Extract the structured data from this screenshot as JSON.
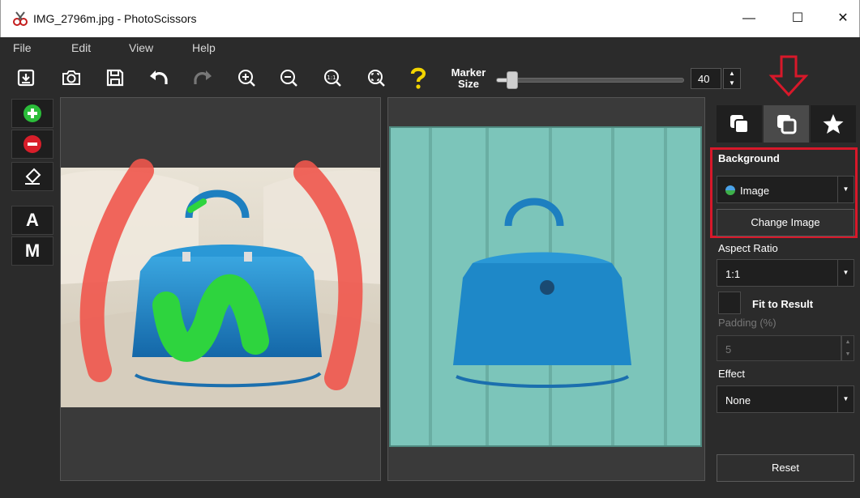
{
  "window": {
    "title": "IMG_2796m.jpg - PhotoScissors",
    "minimize": "—",
    "maximize": "☐",
    "close": "✕"
  },
  "menu": [
    "File",
    "Edit",
    "View",
    "Help"
  ],
  "toolbar": {
    "marker_label_line1": "Marker",
    "marker_label_line2": "Size",
    "marker_size": "40",
    "marker_fraction": 0.05
  },
  "left_tools": {
    "auto_label": "A",
    "manual_label": "M"
  },
  "panel": {
    "background_heading": "Background",
    "background_type": "Image",
    "change_image": "Change Image",
    "aspect_ratio_label": "Aspect Ratio",
    "aspect_ratio_value": "1:1",
    "fit_to_result": "Fit to Result",
    "padding_label": "Padding (%)",
    "padding_value": "5",
    "effect_label": "Effect",
    "effect_value": "None",
    "reset": "Reset"
  },
  "colors": {
    "accent_red": "#d8182a",
    "add_green": "#2bbd3a",
    "remove_red": "#d81e2a",
    "help_yellow": "#f2d400",
    "bag_blue": "#1e88c8",
    "wood_teal": "#7cc5ba"
  }
}
